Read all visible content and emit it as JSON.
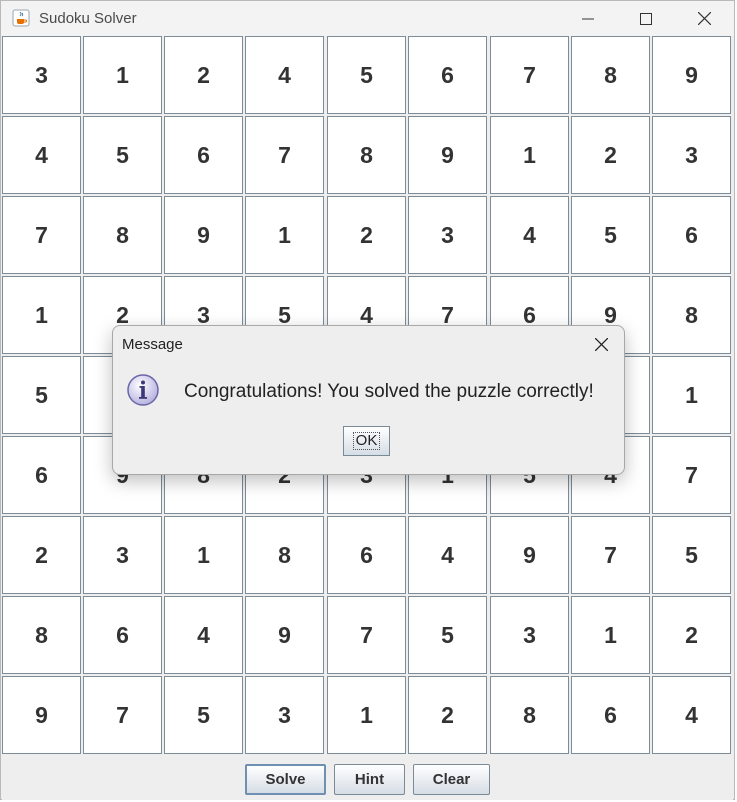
{
  "window": {
    "title": "Sudoku Solver",
    "icon": "java-cup-icon",
    "controls": [
      "minimize-icon",
      "maximize-icon",
      "close-icon"
    ]
  },
  "board": {
    "rows": [
      [
        "3",
        "1",
        "2",
        "4",
        "5",
        "6",
        "7",
        "8",
        "9"
      ],
      [
        "4",
        "5",
        "6",
        "7",
        "8",
        "9",
        "1",
        "2",
        "3"
      ],
      [
        "7",
        "8",
        "9",
        "1",
        "2",
        "3",
        "4",
        "5",
        "6"
      ],
      [
        "1",
        "2",
        "3",
        "5",
        "4",
        "7",
        "6",
        "9",
        "8"
      ],
      [
        "5",
        "",
        "",
        "",
        "",
        "",
        "",
        "",
        "1"
      ],
      [
        "6",
        "9",
        "8",
        "2",
        "3",
        "1",
        "5",
        "4",
        "7"
      ],
      [
        "2",
        "3",
        "1",
        "8",
        "6",
        "4",
        "9",
        "7",
        "5"
      ],
      [
        "8",
        "6",
        "4",
        "9",
        "7",
        "5",
        "3",
        "1",
        "2"
      ],
      [
        "9",
        "7",
        "5",
        "3",
        "1",
        "2",
        "8",
        "6",
        "4"
      ]
    ]
  },
  "buttons": {
    "solve": "Solve",
    "hint": "Hint",
    "clear": "Clear"
  },
  "dialog": {
    "title": "Message",
    "message": "Congratulations! You solved the puzzle correctly!",
    "ok": "OK",
    "icon": "info-icon"
  },
  "colors": {
    "cell_border": "#7c8c99",
    "digit": "#333333",
    "button_border_focus": "#6f8fb3"
  }
}
